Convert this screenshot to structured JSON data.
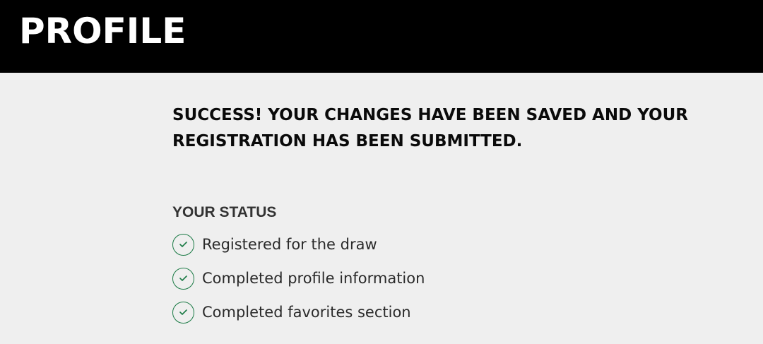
{
  "header": {
    "title": "PROFILE"
  },
  "main": {
    "success_message": "SUCCESS! YOUR CHANGES HAVE BEEN SAVED AND YOUR REGISTRATION HAS BEEN SUBMITTED.",
    "status_heading": "YOUR STATUS",
    "status_items": [
      {
        "label": "Registered for the draw",
        "icon": "check-circle-icon"
      },
      {
        "label": "Completed profile information",
        "icon": "check-circle-icon"
      },
      {
        "label": "Completed favorites section",
        "icon": "check-circle-icon"
      }
    ]
  },
  "colors": {
    "header_bg": "#000000",
    "page_bg": "#efefef",
    "check_accent": "#1b7a45"
  }
}
